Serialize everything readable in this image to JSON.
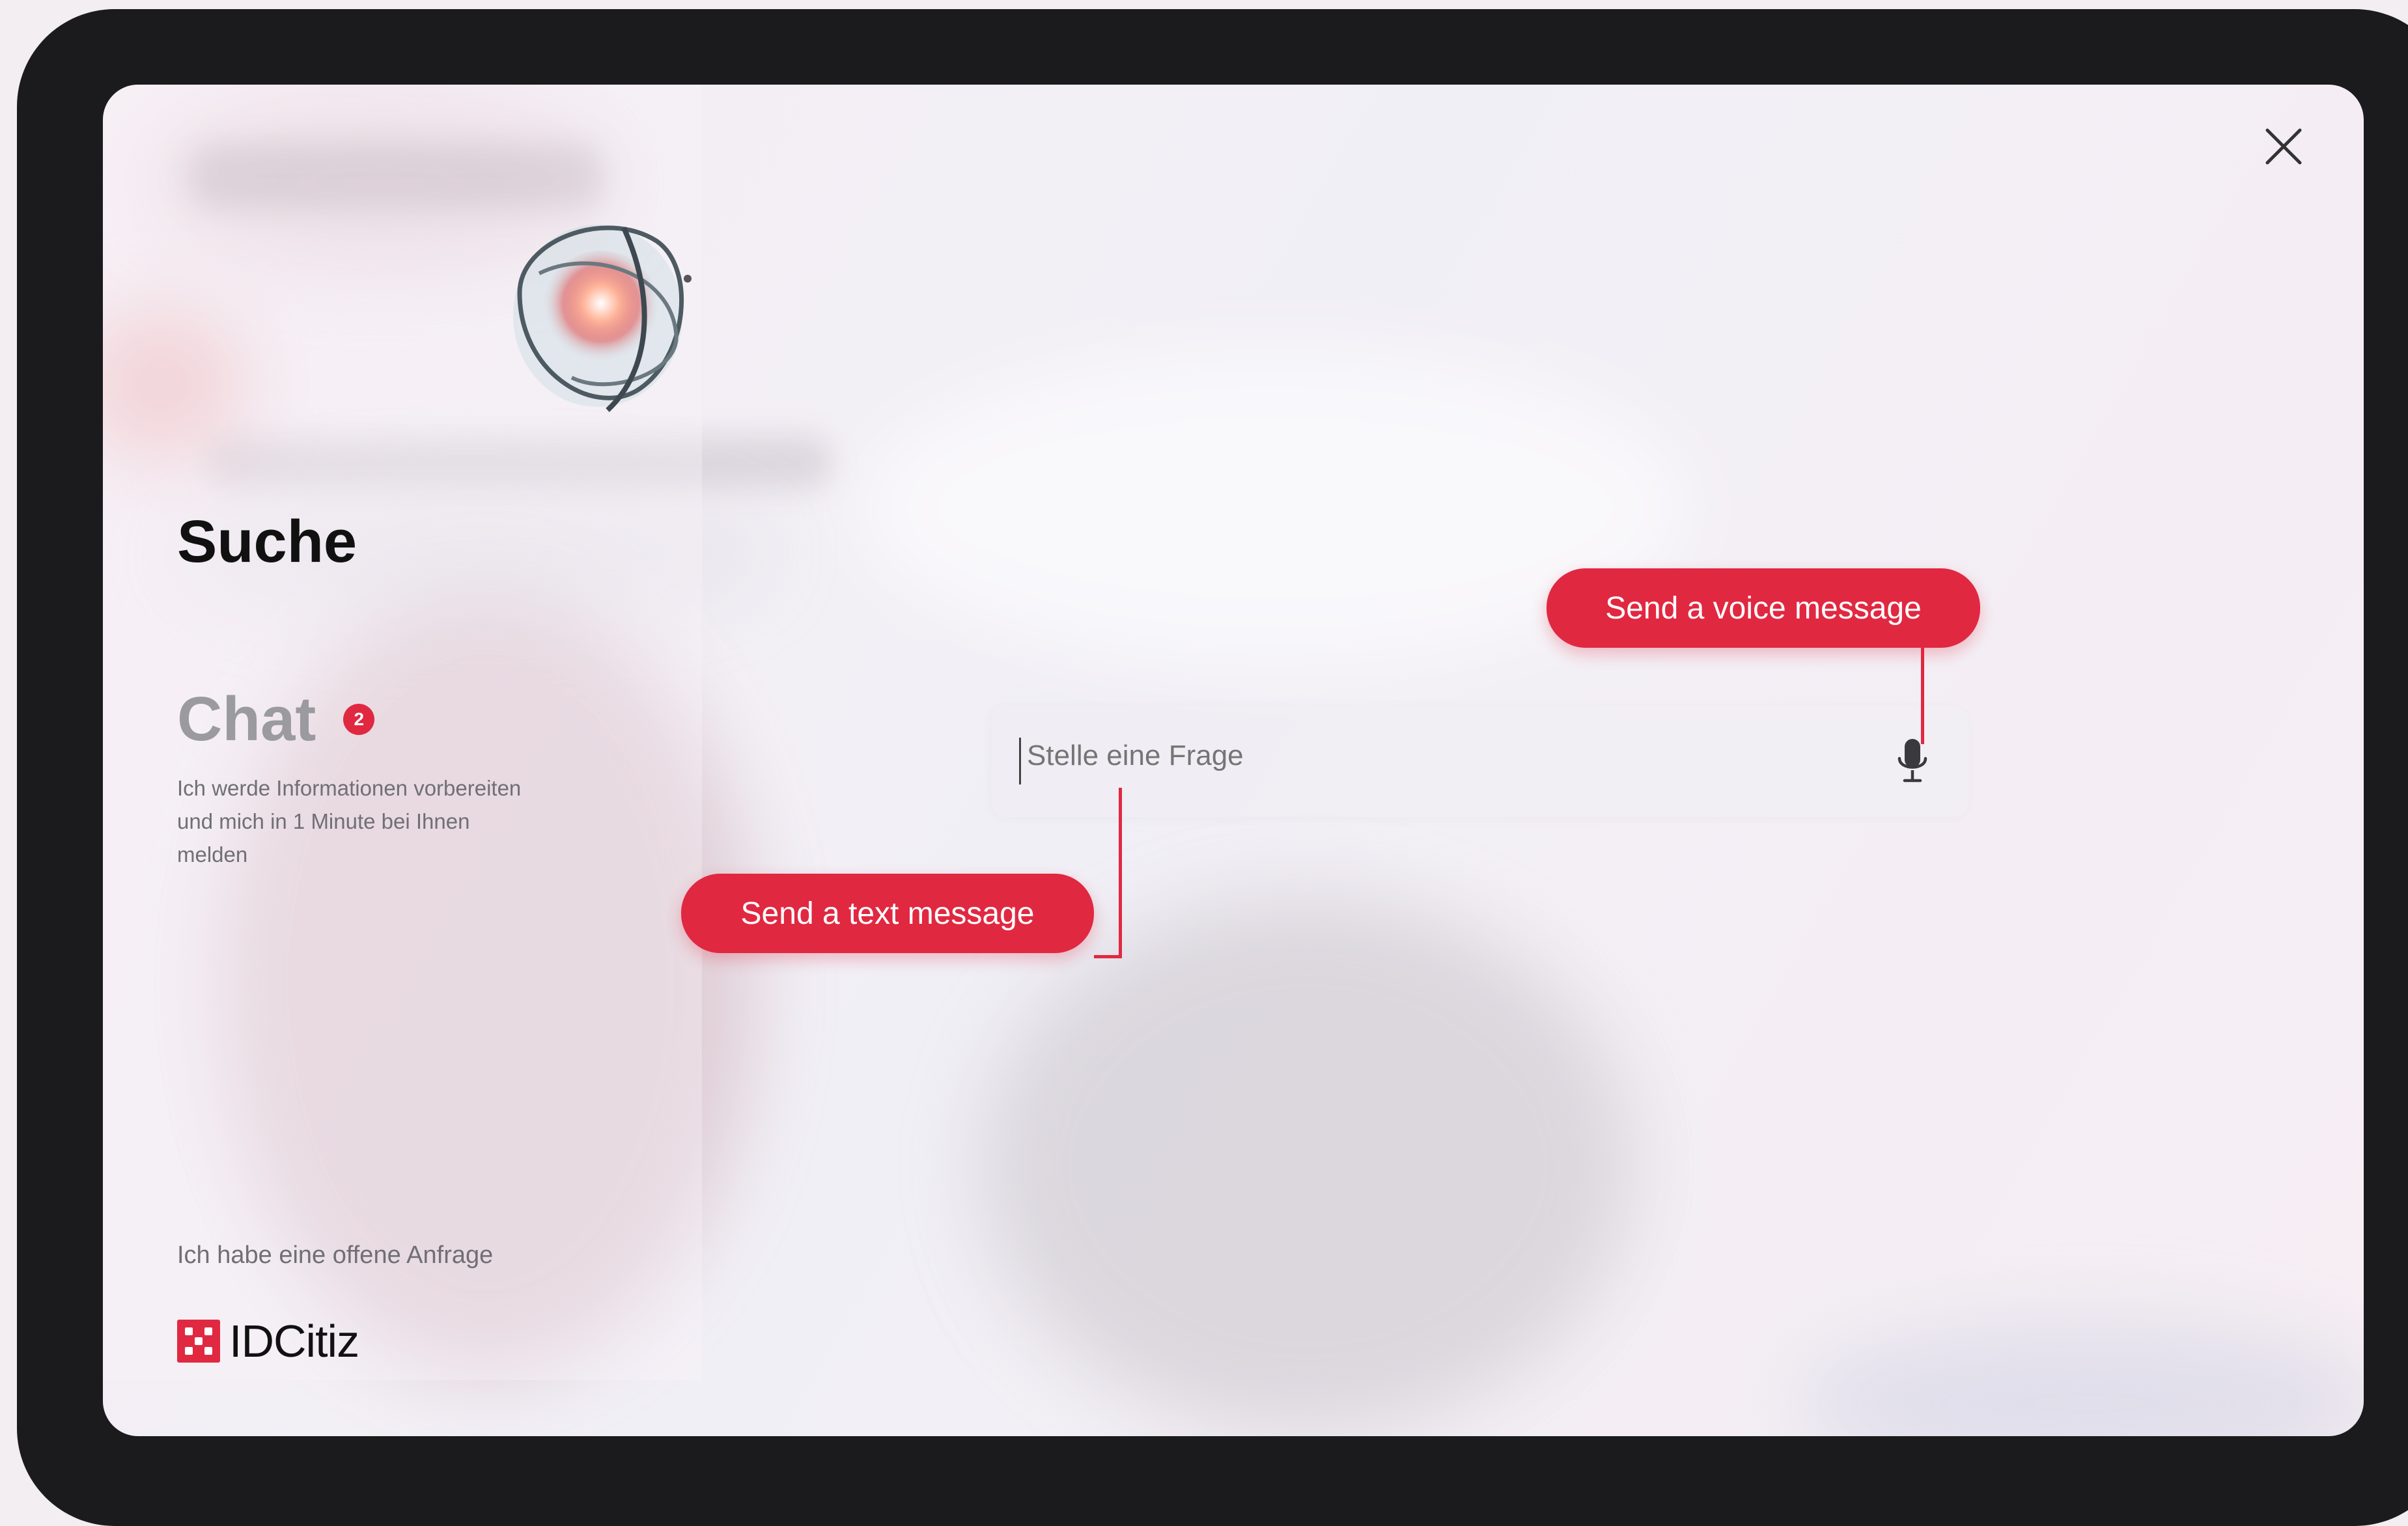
{
  "sidebar": {
    "title": "Suche",
    "chat_title": "Chat",
    "chat_badge": "2",
    "chat_description": "Ich werde Informationen vorbereiten und mich in 1 Minute bei Ihnen melden",
    "open_request_label": "Ich habe eine offene Anfrage",
    "logo_text": "IDCitiz"
  },
  "search": {
    "placeholder": "Stelle eine Frage",
    "value": ""
  },
  "callouts": {
    "voice": "Send a voice message",
    "text": "Send a text message"
  },
  "icons": {
    "close": "close-icon",
    "microphone": "microphone-icon",
    "logo": "logo-icon",
    "orb": "ai-orb-icon"
  },
  "colors": {
    "accent": "#e12841",
    "frame": "#1b1b1d",
    "title": "#111111",
    "muted": "#9a9a9f"
  }
}
